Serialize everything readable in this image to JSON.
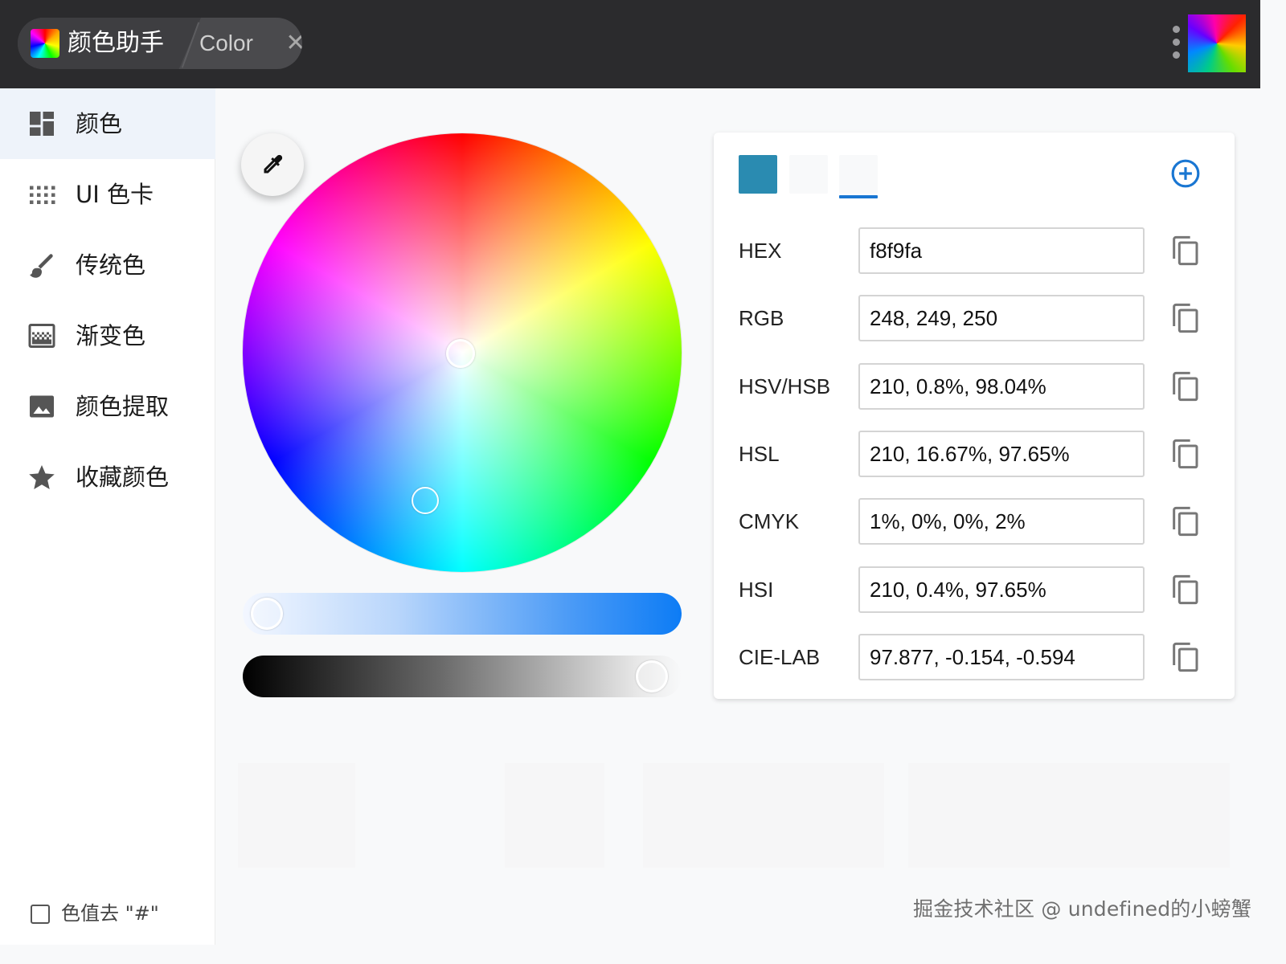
{
  "titlebar": {
    "app_title": "颜色助手",
    "second_tab": "Color",
    "close_glyph": "✕"
  },
  "sidebar": {
    "items": [
      {
        "label": "颜色",
        "icon": "dashboard-icon"
      },
      {
        "label": "UI 色卡",
        "icon": "grid-dots-icon"
      },
      {
        "label": "传统色",
        "icon": "brush-icon"
      },
      {
        "label": "渐变色",
        "icon": "gradient-icon"
      },
      {
        "label": "颜色提取",
        "icon": "image-icon"
      },
      {
        "label": "收藏颜色",
        "icon": "star-icon"
      }
    ],
    "active_index": 0,
    "strip_hash_label": "色值去 \"#\"",
    "strip_hash_checked": false
  },
  "picker": {
    "swatches": [
      "#2a8bb1",
      "#f8f9fa",
      "#f8f9fa"
    ],
    "selected_swatch": 2,
    "accent_color": "#1976d2"
  },
  "formats": [
    {
      "label": "HEX",
      "value": "f8f9fa"
    },
    {
      "label": "RGB",
      "value": "248, 249, 250"
    },
    {
      "label": "HSV/HSB",
      "value": "210, 0.8%, 98.04%"
    },
    {
      "label": "HSL",
      "value": "210, 16.67%, 97.65%"
    },
    {
      "label": "CMYK",
      "value": "1%, 0%, 0%, 2%"
    },
    {
      "label": "HSI",
      "value": "210, 0.4%, 97.65%"
    },
    {
      "label": "CIE-LAB",
      "value": "97.877, -0.154, -0.594"
    }
  ],
  "watermark": "掘金技术社区 @ undefined的小螃蟹"
}
